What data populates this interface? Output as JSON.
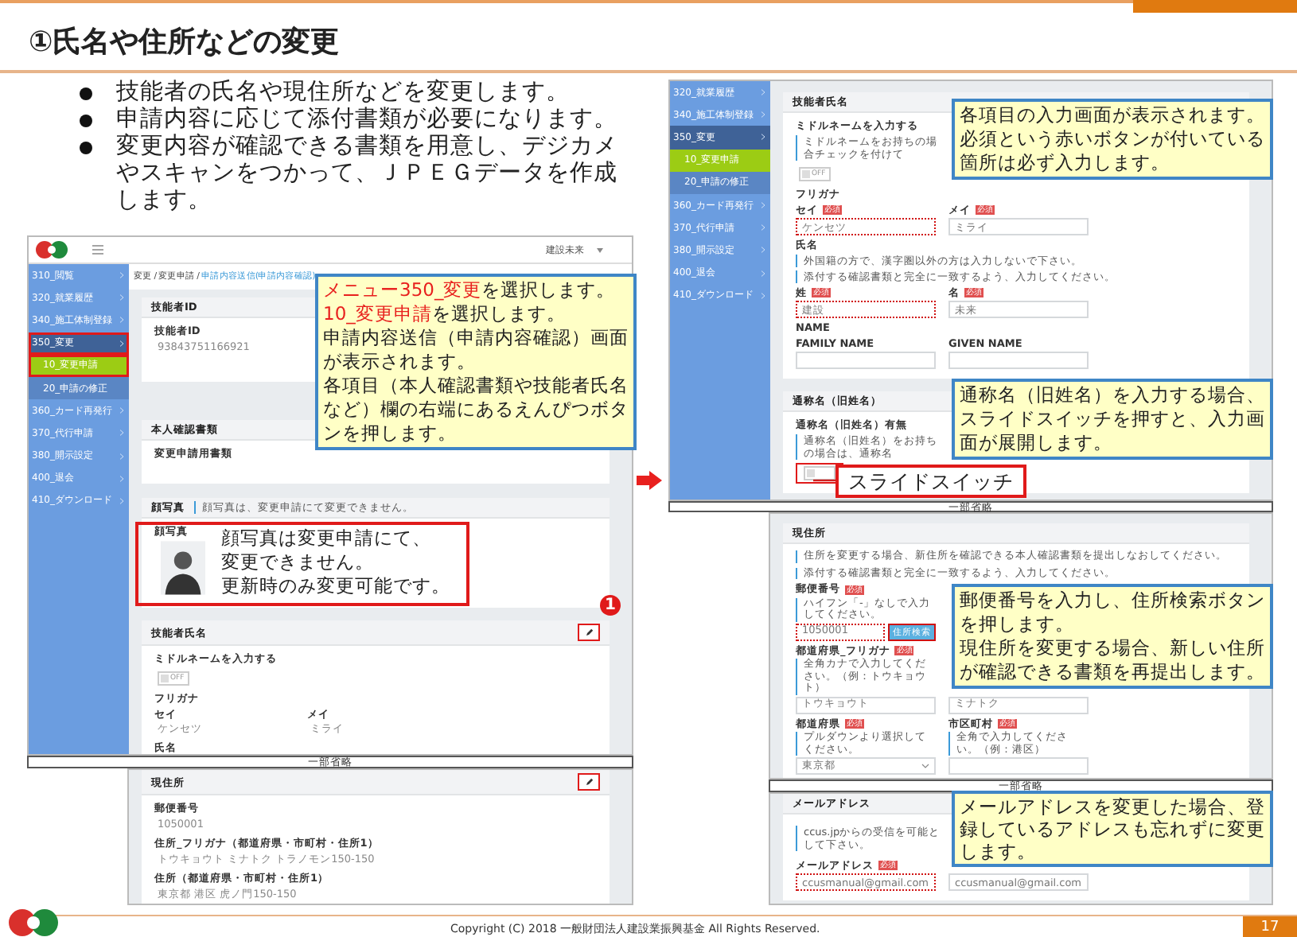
{
  "header": {
    "title": "①氏名や住所などの変更"
  },
  "bullets": [
    "技能者の氏名や現住所などを変更します。",
    "申請内容に応じて添付書類が必要になります。",
    "変更内容が確認できる書類を用意し、デジカメやスキャンをつかって、ＪＰＥＧデータを作成します。"
  ],
  "windows": [
    {
      "topbar": {
        "user": "建設未来"
      },
      "sidebar": [
        {
          "label": "310_閲覧",
          "kind": "menu",
          "selected": false,
          "highlighted": false
        },
        {
          "label": "320_就業履歴",
          "kind": "menu",
          "selected": false,
          "highlighted": false
        },
        {
          "label": "340_施工体制登録",
          "kind": "menu",
          "selected": false,
          "highlighted": false
        },
        {
          "label": "350_変更",
          "kind": "menu",
          "selected": true,
          "highlighted": true
        },
        {
          "label": "10_変更申請",
          "kind": "submenu",
          "selected": true,
          "highlighted": true
        },
        {
          "label": "20_申請の修正",
          "kind": "submenu",
          "selected": false,
          "highlighted": false
        },
        {
          "label": "360_カード再発行",
          "kind": "menu",
          "selected": false,
          "highlighted": false
        },
        {
          "label": "370_代行申請",
          "kind": "menu",
          "selected": false,
          "highlighted": false
        },
        {
          "label": "380_開示設定",
          "kind": "menu",
          "selected": false,
          "highlighted": false
        },
        {
          "label": "400_退会",
          "kind": "menu",
          "selected": false,
          "highlighted": false
        },
        {
          "label": "410_ダウンロード",
          "kind": "menu",
          "selected": false,
          "highlighted": false
        }
      ],
      "breadcrumb": [
        {
          "text": "変更 / 変更申請 / ",
          "current": false
        },
        {
          "text": "申請内容送信(申請内容確認)",
          "current": true
        }
      ],
      "panels": [
        {
          "title": "技能者ID",
          "items": [
            {
              "kind": "heading",
              "text": "技能者ID"
            },
            {
              "kind": "text",
              "text": "93843751166921"
            }
          ]
        },
        {
          "title": "本人確認書類",
          "items": [
            {
              "kind": "heading",
              "text": "変更申請用書類"
            }
          ]
        },
        {
          "title": "顔写真",
          "note": "顔写真は、変更申請にて変更できません。",
          "items": [
            {
              "kind": "photo",
              "text": "顔写真"
            }
          ]
        },
        {
          "title": "技能者氏名",
          "edit": {
            "highlighted": true
          },
          "items": [
            {
              "kind": "heading",
              "text": "ミドルネームを入力する"
            },
            {
              "kind": "toggle",
              "on": false,
              "text": "OFF",
              "highlighted": false
            },
            {
              "kind": "heading",
              "text": "フリガナ"
            },
            {
              "kind": "pairs",
              "columns": [
                {
                  "label": "セイ",
                  "value": "ケンセツ"
                },
                {
                  "label": "メイ",
                  "value": "ミライ"
                }
              ]
            },
            {
              "kind": "heading",
              "text": "氏名"
            }
          ]
        }
      ]
    },
    {
      "panels": [
        {
          "title": "現住所",
          "edit": {
            "highlighted": true
          },
          "items": [
            {
              "kind": "heading",
              "text": "郵便番号"
            },
            {
              "kind": "text",
              "text": "1050001"
            },
            {
              "kind": "heading",
              "text": "住所_フリガナ（都道府県・市町村・住所1）"
            },
            {
              "kind": "text",
              "text": "トウキョウト ミナトク トラノモン150-150"
            },
            {
              "kind": "heading",
              "text": "住所（都道府県・市町村・住所1）"
            },
            {
              "kind": "text",
              "text": "東京都 港区 虎ノ門150-150"
            }
          ]
        }
      ]
    },
    {
      "sidebar": [
        {
          "label": "320_就業履歴",
          "kind": "menu",
          "selected": false,
          "highlighted": false
        },
        {
          "label": "340_施工体制登録",
          "kind": "menu",
          "selected": false,
          "highlighted": false
        },
        {
          "label": "350_変更",
          "kind": "menu",
          "selected": true,
          "highlighted": false
        },
        {
          "label": "10_変更申請",
          "kind": "submenu",
          "selected": true,
          "highlighted": false
        },
        {
          "label": "20_申請の修正",
          "kind": "submenu",
          "selected": false,
          "highlighted": false
        },
        {
          "label": "360_カード再発行",
          "kind": "menu",
          "selected": false,
          "highlighted": false
        },
        {
          "label": "370_代行申請",
          "kind": "menu",
          "selected": false,
          "highlighted": false
        },
        {
          "label": "380_開示設定",
          "kind": "menu",
          "selected": false,
          "highlighted": false
        },
        {
          "label": "400_退会",
          "kind": "menu",
          "selected": false,
          "highlighted": false
        },
        {
          "label": "410_ダウンロード",
          "kind": "menu",
          "selected": false,
          "highlighted": false
        }
      ],
      "panels": [
        {
          "title": "技能者氏名",
          "items": [
            {
              "kind": "heading",
              "text": "ミドルネームを入力する"
            },
            {
              "kind": "note",
              "text": "ミドルネームをお持ちの場合チェックを付けて"
            },
            {
              "kind": "toggle",
              "on": false,
              "text": "OFF",
              "highlighted": false
            },
            {
              "kind": "heading",
              "text": "フリガナ"
            },
            {
              "kind": "fields",
              "fields": [
                {
                  "kind": "input",
                  "label": "セイ",
                  "badge": "必須",
                  "value": "ケンセツ",
                  "highlighted": true
                },
                {
                  "kind": "input",
                  "label": "メイ",
                  "badge": "必須",
                  "value": "ミライ",
                  "highlighted": false
                }
              ]
            },
            {
              "kind": "heading",
              "text": "氏名"
            },
            {
              "kind": "note",
              "text": "外国籍の方で、漢字圏以外の方は入力しないで下さい。"
            },
            {
              "kind": "note",
              "text": "添付する確認書類と完全に一致するよう、入力してください。"
            },
            {
              "kind": "fields",
              "fields": [
                {
                  "kind": "input",
                  "label": "姓",
                  "badge": "必須",
                  "value": "建設",
                  "highlighted": true
                },
                {
                  "kind": "input",
                  "label": "名",
                  "badge": "必須",
                  "value": "未来",
                  "highlighted": false
                }
              ]
            },
            {
              "kind": "heading",
              "text": "NAME"
            },
            {
              "kind": "fields",
              "fields": [
                {
                  "kind": "input",
                  "label": "FAMILY NAME",
                  "highlighted": false
                },
                {
                  "kind": "input",
                  "label": "GIVEN NAME",
                  "highlighted": false
                }
              ]
            }
          ]
        },
        {
          "title": "通称名（旧姓名）",
          "items": [
            {
              "kind": "heading",
              "text": "通称名（旧姓名）有無"
            },
            {
              "kind": "note",
              "text": "通称名（旧姓名）をお持ちの場合は、通称名"
            },
            {
              "kind": "toggle",
              "on": false,
              "highlighted": true
            }
          ]
        }
      ]
    },
    {
      "panels": [
        {
          "title": "現住所",
          "items": [
            {
              "kind": "note",
              "text": "住所を変更する場合、新住所を確認できる本人確認書類を提出しなおしてください。"
            },
            {
              "kind": "note",
              "text": "添付する確認書類と完全に一致するよう、入力してください。"
            },
            {
              "kind": "fields",
              "fields": [
                {
                  "kind": "input",
                  "label": "郵便番号",
                  "badge": "必須",
                  "note": "ハイフン「-」なしで入力してください。",
                  "value": "1050001",
                  "highlighted": true,
                  "button": {
                    "text": "住所検索",
                    "highlighted": true
                  }
                }
              ]
            },
            {
              "kind": "fields",
              "fields": [
                {
                  "kind": "input",
                  "label": "都道府県_フリガナ",
                  "badge": "必須",
                  "note": "全角カナで入力してください。（例：トウキョウト）",
                  "value": "トウキョウト",
                  "highlighted": false
                },
                {
                  "kind": "input",
                  "value": "ミナトク",
                  "highlighted": false
                }
              ]
            },
            {
              "kind": "fields",
              "fields": [
                {
                  "kind": "select",
                  "label": "都道府県",
                  "badge": "必須",
                  "note": "プルダウンより選択してください。",
                  "value": "東京都",
                  "highlighted": false
                },
                {
                  "kind": "input",
                  "label": "市区町村",
                  "badge": "必須",
                  "note": "全角で入力してください。（例：港区）",
                  "highlighted": false
                }
              ]
            }
          ]
        }
      ]
    },
    {
      "panels": [
        {
          "title": "メールアドレス",
          "items": [
            {
              "kind": "note",
              "text": "ccus.jpからの受信を可能として下さい。"
            },
            {
              "kind": "fields",
              "fields": [
                {
                  "kind": "input",
                  "label": "メールアドレス",
                  "badge": "必須",
                  "value": "ccusmanual@gmail.com",
                  "highlighted": true
                },
                {
                  "kind": "input",
                  "value": "ccusmanual@gmail.com",
                  "highlighted": false
                }
              ]
            }
          ]
        }
      ]
    }
  ],
  "omissions": [
    "一部省略",
    "一部省略",
    "一部省略"
  ],
  "callouts": [
    {
      "kind": "note",
      "paragraphs": [
        [
          {
            "text": "メニュー350_変更",
            "emphasis": true
          },
          {
            "text": "を選択します。",
            "emphasis": false
          }
        ],
        [
          {
            "text": "10_変更申請",
            "emphasis": true
          },
          {
            "text": "を選択します。",
            "emphasis": false
          }
        ],
        [
          {
            "text": "申請内容送信（申請内容確認）画面が表示されます。",
            "emphasis": false
          }
        ],
        [
          {
            "text": "各項目（本人確認書類や技能者氏名など）欄の右端にあるえんぴつボタンを押します。",
            "emphasis": false
          }
        ]
      ]
    },
    {
      "kind": "frame",
      "paragraphs": [
        [
          {
            "text": "顔写真は変更申請にて、",
            "emphasis": false
          }
        ],
        [
          {
            "text": "変更できません。",
            "emphasis": false
          }
        ],
        [
          {
            "text": "更新時のみ変更可能です。",
            "emphasis": false
          }
        ]
      ]
    },
    {
      "kind": "note",
      "paragraphs": [
        [
          {
            "text": "各項目の入力画面が表示されます。必須という赤いボタンが付いている箇所は必ず入力します。",
            "emphasis": false
          }
        ]
      ]
    },
    {
      "kind": "note",
      "paragraphs": [
        [
          {
            "text": "通称名（旧姓名）を入力する場合、スライドスイッチを押すと、入力画面が展開します。",
            "emphasis": false
          }
        ]
      ]
    },
    {
      "kind": "label",
      "paragraphs": [
        [
          {
            "text": "スライドスイッチ",
            "emphasis": false
          }
        ]
      ]
    },
    {
      "kind": "note",
      "paragraphs": [
        [
          {
            "text": "郵便番号を入力し、住所検索ボタンを押します。",
            "emphasis": false
          }
        ],
        [
          {
            "text": "現住所を変更する場合、新しい住所が確認できる書類を再提出します。",
            "emphasis": false
          }
        ]
      ]
    },
    {
      "kind": "note",
      "paragraphs": [
        [
          {
            "text": "メールアドレスを変更した場合、登録しているアドレスも忘れずに変更します。",
            "emphasis": false
          }
        ]
      ]
    }
  ],
  "step_badge": "1",
  "footer": {
    "copyright": "Copyright (C) 2018 一般財団法人建設業振興基金 All Rights Reserved.",
    "page": "17"
  }
}
